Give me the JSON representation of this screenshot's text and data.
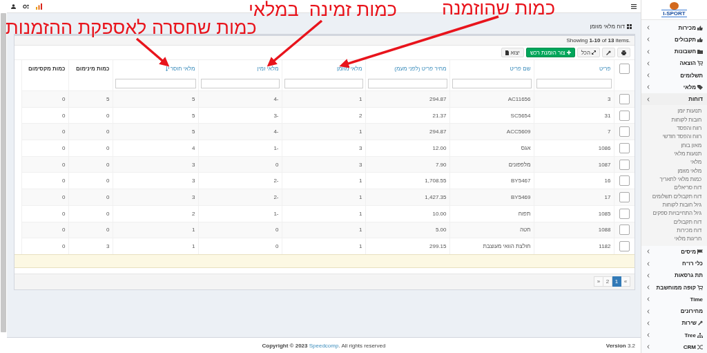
{
  "topbar": {
    "logo_text": "I-SPORT"
  },
  "annotations": [
    {
      "text": "כמות שהוזמנה"
    },
    {
      "text": "כמות זמינה  במלאי"
    },
    {
      "text": "כמות שחסרה לאספקת ההזמנות"
    }
  ],
  "page": {
    "title": "דוח מלאי מוזמן",
    "summary": "Showing **1-10** of **13** items."
  },
  "toolbar": [
    {
      "kind": "print"
    },
    {
      "kind": "wrench"
    },
    {
      "kind": "expand",
      "label": "הכל"
    },
    {
      "kind": "create",
      "label": "צור הזמנת רכש"
    },
    {
      "kind": "export",
      "label": "יצוא"
    }
  ],
  "table": {
    "select_all_checked": false,
    "columns": [
      {
        "label": "פריט",
        "sortable": true,
        "sorted": false,
        "filter": true
      },
      {
        "label": "שם פריט",
        "sortable": true,
        "sorted": false,
        "filter": true
      },
      {
        "label": "מחיר פריט (לפני מעמ)",
        "sortable": true,
        "sorted": false,
        "filter": true
      },
      {
        "label": "מלאי מוזמן",
        "sortable": true,
        "sorted": false,
        "filter": true
      },
      {
        "label": "מלאי זמין",
        "sortable": true,
        "sorted": false,
        "filter": true
      },
      {
        "label": "מלאי חוסר",
        "sortable": true,
        "sorted": true,
        "filter": true
      },
      {
        "label": "כמות מינימום",
        "sortable": false,
        "sorted": false,
        "filter": false
      },
      {
        "label": "כמות מקסימום",
        "sortable": false,
        "sorted": false,
        "filter": false
      }
    ],
    "rows": [
      {
        "checked": false,
        "cells": [
          "3",
          "AC11656",
          "294.87",
          "1",
          "-4",
          "5",
          "5",
          "0"
        ]
      },
      {
        "checked": false,
        "cells": [
          "31",
          "SC5654",
          "21.37",
          "2",
          "-3",
          "5",
          "0",
          "0"
        ]
      },
      {
        "checked": false,
        "cells": [
          "7",
          "ACC5609",
          "294.87",
          "1",
          "-4",
          "5",
          "0",
          "0"
        ]
      },
      {
        "checked": false,
        "cells": [
          "1086",
          "אגס",
          "12.00",
          "3",
          "-1",
          "4",
          "0",
          "0"
        ]
      },
      {
        "checked": false,
        "cells": [
          "1087",
          "מלפפונים",
          "7.90",
          "3",
          "0",
          "3",
          "0",
          "0"
        ]
      },
      {
        "checked": false,
        "cells": [
          "16",
          "BY5467",
          "1,708.55",
          "1",
          "-2",
          "3",
          "0",
          "0"
        ]
      },
      {
        "checked": false,
        "cells": [
          "17",
          "BY5469",
          "1,427.35",
          "1",
          "-2",
          "3",
          "0",
          "0"
        ]
      },
      {
        "checked": false,
        "cells": [
          "1085",
          "תפוח",
          "10.00",
          "1",
          "-1",
          "2",
          "0",
          "0"
        ]
      },
      {
        "checked": false,
        "cells": [
          "1088",
          "חטה",
          "5.00",
          "1",
          "0",
          "1",
          "0",
          "0"
        ]
      },
      {
        "checked": false,
        "cells": [
          "1182",
          "חולצת הוואי מעוצבת",
          "299.15",
          "1",
          "0",
          "1",
          "3",
          "0"
        ]
      }
    ]
  },
  "pagination": [
    {
      "label": "»",
      "selected": false
    },
    {
      "label": "1",
      "selected": true
    },
    {
      "label": "2",
      "selected": false
    },
    {
      "label": "«",
      "selected": false
    }
  ],
  "footer": {
    "copyright_before": "Copyright © 2023 ",
    "company_link": "Speedcomp",
    "copyright_after": ". All rights reserved",
    "version_label": "Version",
    "version": "3.2"
  },
  "sidebar": {
    "items": [
      {
        "label": "מכירות",
        "expanded": false
      },
      {
        "label": "תקבולים",
        "expanded": false
      },
      {
        "label": "חשבונות",
        "expanded": false
      },
      {
        "label": "הוצאה",
        "expanded": false
      },
      {
        "label": "תשלומים",
        "expanded": false
      },
      {
        "label": "מלאי",
        "expanded": false
      },
      {
        "label": "דוחות",
        "expanded": true,
        "children": [
          {
            "label": "תנועות יומן"
          },
          {
            "label": "חובות לקוחות"
          },
          {
            "label": "רווח והפסד"
          },
          {
            "label": "רווח והפסד חודשי"
          },
          {
            "label": "מאזן בוחן"
          },
          {
            "label": "תנועות מלאי"
          },
          {
            "label": "מלאי"
          },
          {
            "label": "מלאי מוזמן"
          },
          {
            "label": "כמות מלאי לתאריך"
          },
          {
            "label": "דוח סריאלים"
          },
          {
            "label": "דוח תקבולים תשלומים"
          },
          {
            "label": "גיול חובות לקוחות"
          },
          {
            "label": "גיול התחייבויות ספקים"
          },
          {
            "label": "דוח תקבולים"
          },
          {
            "label": "דוח מכירות"
          },
          {
            "label": "חריגות מלאי"
          }
        ]
      },
      {
        "label": "מיסים",
        "expanded": false
      },
      {
        "label": "כלי רו\"ח",
        "expanded": false
      },
      {
        "label": "תת גרסאות",
        "expanded": false
      },
      {
        "label": "קופה ממוחשבת",
        "expanded": false
      },
      {
        "label": "Time",
        "expanded": false
      },
      {
        "label": "מחירונים",
        "expanded": false
      },
      {
        "label": "שירות",
        "expanded": false
      },
      {
        "label": "Tree",
        "expanded": false
      },
      {
        "label": "CRM",
        "expanded": false
      }
    ]
  }
}
